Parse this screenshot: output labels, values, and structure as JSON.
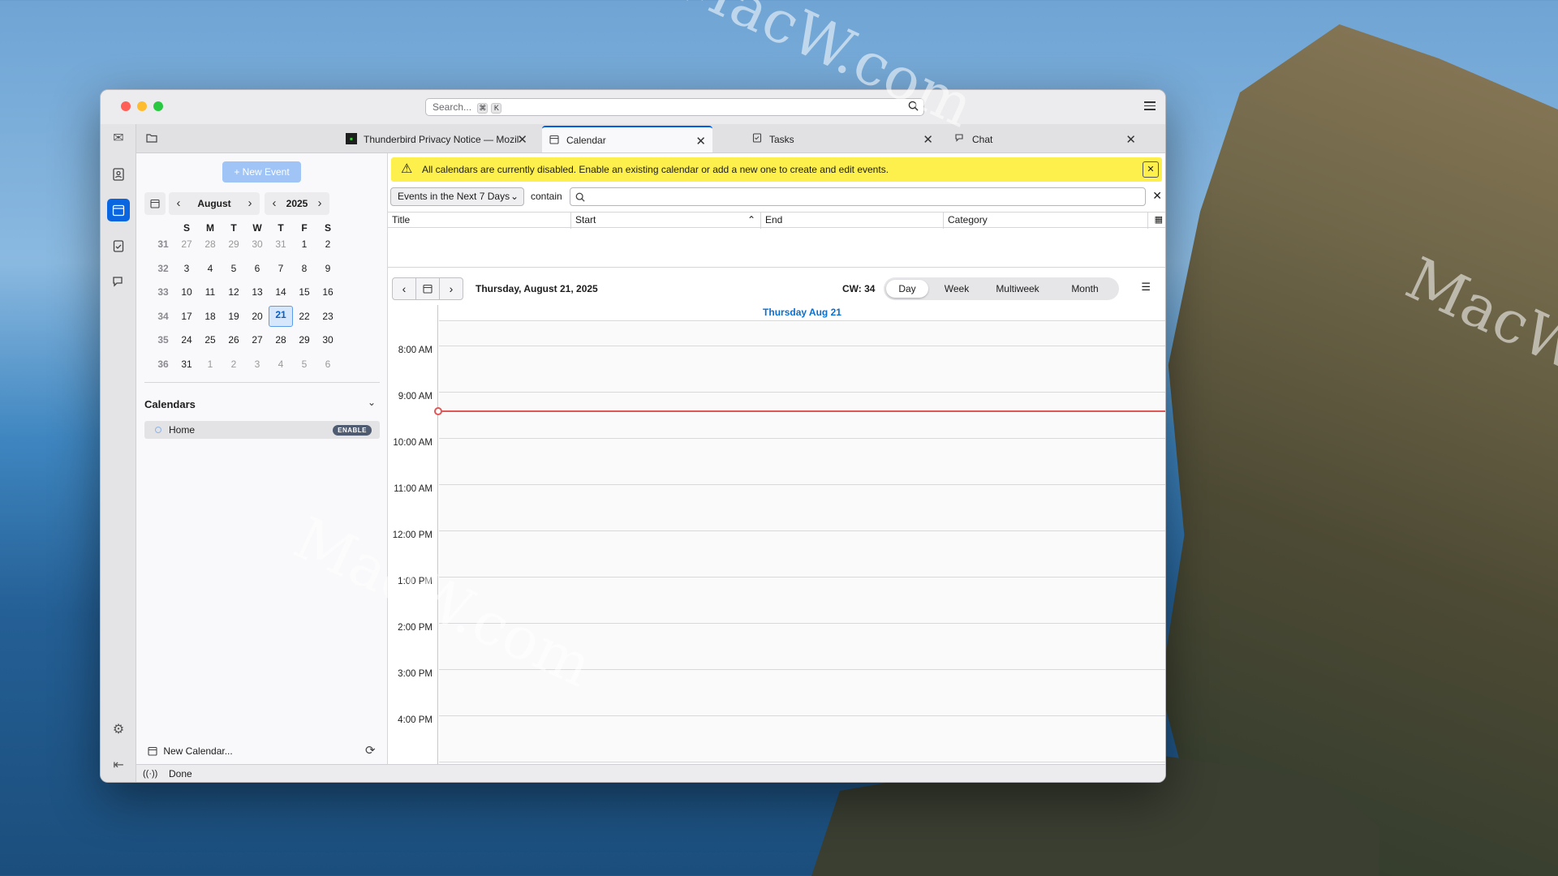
{
  "window": {
    "search_placeholder": "Search...",
    "search_keys": [
      "⌘",
      "K"
    ]
  },
  "tabs": [
    {
      "label": "Thunderbird Privacy Notice — Mozil",
      "icon": "thunderbird-icon"
    },
    {
      "label": "Calendar",
      "icon": "calendar-icon",
      "active": true
    },
    {
      "label": "Tasks",
      "icon": "tasks-icon"
    },
    {
      "label": "Chat",
      "icon": "chat-icon"
    }
  ],
  "left": {
    "new_event": "+ New Event",
    "month": "August",
    "year": "2025",
    "weekdays": [
      "S",
      "M",
      "T",
      "W",
      "T",
      "F",
      "S"
    ],
    "weeks": [
      {
        "wk": "31",
        "days": [
          "27",
          "28",
          "29",
          "30",
          "31",
          "1",
          "2"
        ]
      },
      {
        "wk": "32",
        "days": [
          "3",
          "4",
          "5",
          "6",
          "7",
          "8",
          "9"
        ]
      },
      {
        "wk": "33",
        "days": [
          "10",
          "11",
          "12",
          "13",
          "14",
          "15",
          "16"
        ]
      },
      {
        "wk": "34",
        "days": [
          "17",
          "18",
          "19",
          "20",
          "21",
          "22",
          "23"
        ]
      },
      {
        "wk": "35",
        "days": [
          "24",
          "25",
          "26",
          "27",
          "28",
          "29",
          "30"
        ]
      },
      {
        "wk": "36",
        "days": [
          "31",
          "1",
          "2",
          "3",
          "4",
          "5",
          "6"
        ]
      }
    ],
    "calendars_header": "Calendars",
    "calendar_name": "Home",
    "enable_badge": "ENABLE",
    "new_calendar": "New Calendar..."
  },
  "notice": "All calendars are currently disabled. Enable an existing calendar or add a new one to create and edit events.",
  "filter": {
    "selected": "Events in the Next 7 Days",
    "contain": "contain"
  },
  "columns": [
    "Title",
    "Start",
    "End",
    "Category"
  ],
  "dayview": {
    "date_label": "Thursday, August 21, 2025",
    "cw": "CW: 34",
    "views": [
      "Day",
      "Week",
      "Multiweek",
      "Month"
    ],
    "active_view": "Day",
    "day_header": "Thursday Aug 21",
    "hours": [
      "8:00 AM",
      "9:00 AM",
      "10:00 AM",
      "11:00 AM",
      "12:00 PM",
      "1:00 PM",
      "2:00 PM",
      "3:00 PM",
      "4:00 PM"
    ]
  },
  "status": "Done",
  "watermark": "MacW.com",
  "colors": {
    "accent": "#0060df",
    "notice": "#fdf04d",
    "now_line": "#e05757"
  }
}
